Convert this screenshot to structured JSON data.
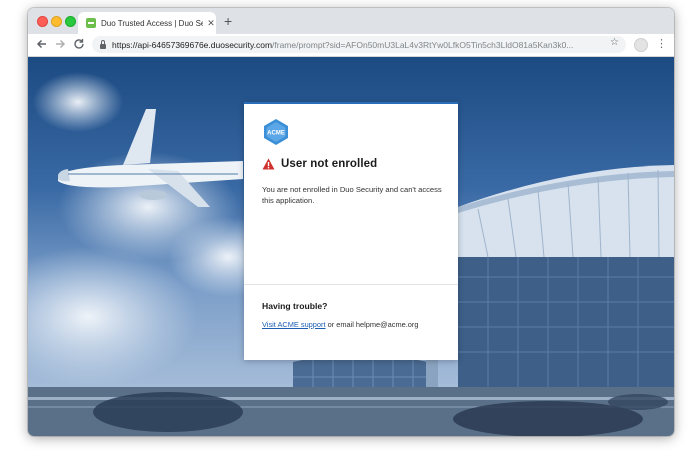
{
  "browser": {
    "tab_title": "Duo Trusted Access | Duo Sec",
    "tab_close": "✕",
    "new_tab": "+",
    "url_host": "https://api-64657369676e.duosecurity.com",
    "url_rest": "/frame/prompt?sid=AFOn50mU3LaL4v3RtYw0LfkO5Tin5ch3LldO81a5Kan3k0...",
    "icons": {
      "back": "back-arrow-icon",
      "forward": "forward-arrow-icon",
      "reload": "reload-icon",
      "lock": "lock-icon",
      "star": "star-icon",
      "profile": "profile-icon",
      "menu": "kebab-menu-icon"
    }
  },
  "card": {
    "logo_text": "ACME",
    "error_title": "User not enrolled",
    "error_message": "You are not enrolled in Duo Security and can't access this application.",
    "trouble_title": "Having trouble?",
    "help_link_label": "Visit ACME support",
    "help_suffix": " or email helpme@acme.org"
  },
  "colors": {
    "accent": "#2a6db8",
    "error": "#d0312d",
    "link": "#1a5fb4"
  }
}
